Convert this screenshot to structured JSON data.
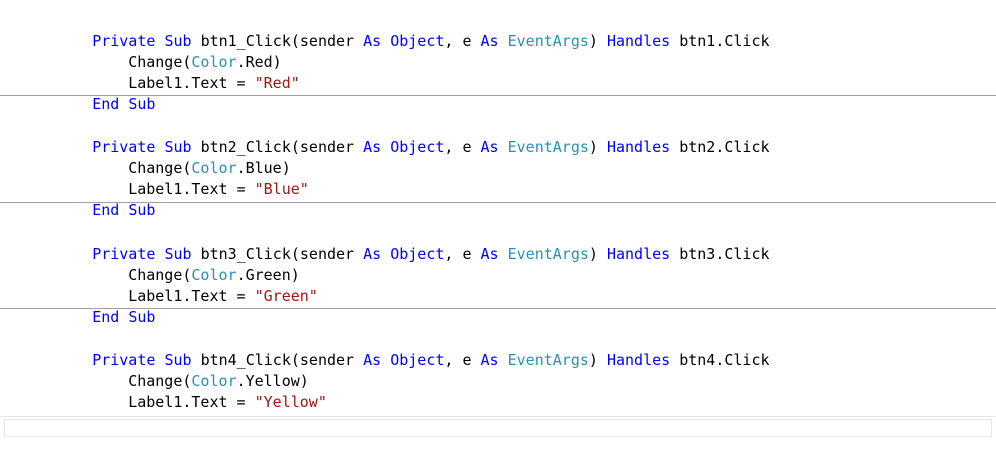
{
  "editor": {
    "language": "VB.NET",
    "colors": {
      "keyword": "#0000ff",
      "type": "#2b91af",
      "string": "#a31515",
      "text": "#000000",
      "separator": "#a0a0a0"
    },
    "tokens": {
      "private": "Private",
      "sub": "Sub",
      "as": "As",
      "object": "Object",
      "event_args": "EventArgs",
      "handles": "Handles",
      "end": "End",
      "color": "Color",
      "params_mid": ", e ",
      "close_paren_space": ") ",
      "change_open": "Change(",
      "label_text": "Label1.Text = "
    },
    "methods": [
      {
        "name": "btn1_Click(sender ",
        "handles": " btn1.Click",
        "color_arg": ".Red)",
        "label_value": "\"Red\""
      },
      {
        "name": "btn2_Click(sender ",
        "handles": " btn2.Click",
        "color_arg": ".Blue)",
        "label_value": "\"Blue\""
      },
      {
        "name": "btn3_Click(sender ",
        "handles": " btn3.Click",
        "color_arg": ".Green)",
        "label_value": "\"Green\""
      },
      {
        "name": "btn4_Click(sender ",
        "handles": " btn4.Click",
        "color_arg": ".Yellow)",
        "label_value": "\"Yellow\""
      }
    ]
  }
}
